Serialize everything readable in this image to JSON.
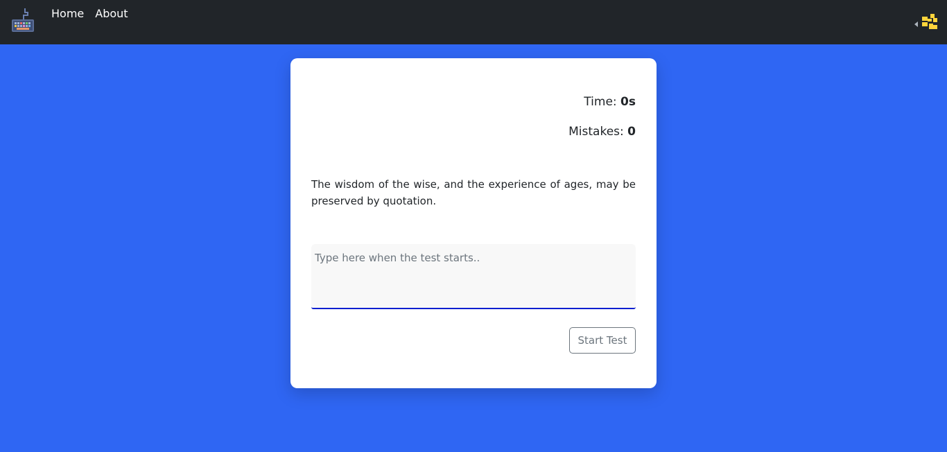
{
  "navbar": {
    "logo_icon": "keyboard-icon",
    "links": [
      {
        "label": "Home"
      },
      {
        "label": "About"
      }
    ],
    "theme_toggle_icon": "pixel-sun-icon",
    "accent_color": "#ffd43b"
  },
  "card": {
    "time_label": "Time: ",
    "time_value": "0s",
    "mistakes_label": "Mistakes: ",
    "mistakes_value": "0",
    "quote": "The wisdom of the wise, and the experience of ages, may be preserved by quotation.",
    "input_placeholder": "Type here when the test starts..",
    "input_value": "",
    "start_button_label": "Start Test"
  },
  "colors": {
    "background": "#2f66f3",
    "navbar": "#212529",
    "input_underline": "#0d1fd0"
  }
}
